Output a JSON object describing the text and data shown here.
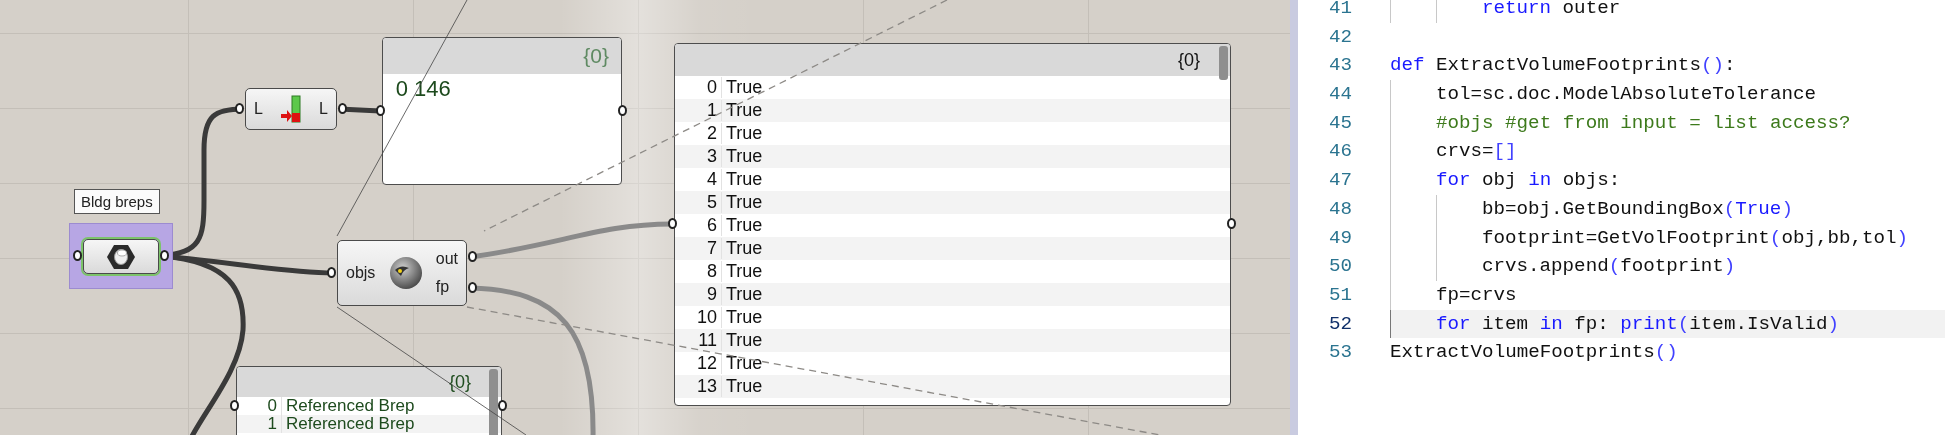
{
  "canvas": {
    "nodes": [
      {
        "kind": "param",
        "tooltip": "Bldg breps",
        "selected": true
      },
      {
        "kind": "list_length",
        "inputs": [
          "L"
        ],
        "outputs": [
          "L"
        ],
        "selected": false
      },
      {
        "kind": "python",
        "inputs": [
          "objs"
        ],
        "outputs": [
          "out",
          "fp"
        ],
        "selected": false
      }
    ],
    "panels": [
      {
        "kind": "number",
        "header": "{0}",
        "rows": [
          {
            "index": "0",
            "value": "146"
          }
        ]
      },
      {
        "kind": "boolean",
        "header": "{0}",
        "rows": [
          {
            "index": "0",
            "value": "True"
          },
          {
            "index": "1",
            "value": "True"
          },
          {
            "index": "2",
            "value": "True"
          },
          {
            "index": "3",
            "value": "True"
          },
          {
            "index": "4",
            "value": "True"
          },
          {
            "index": "5",
            "value": "True"
          },
          {
            "index": "6",
            "value": "True"
          },
          {
            "index": "7",
            "value": "True"
          },
          {
            "index": "8",
            "value": "True"
          },
          {
            "index": "9",
            "value": "True"
          },
          {
            "index": "10",
            "value": "True"
          },
          {
            "index": "11",
            "value": "True"
          },
          {
            "index": "12",
            "value": "True"
          },
          {
            "index": "13",
            "value": "True"
          }
        ]
      },
      {
        "kind": "brep",
        "header": "{0}",
        "rows": [
          {
            "index": "0",
            "value": "Referenced Brep"
          },
          {
            "index": "1",
            "value": "Referenced Brep"
          }
        ]
      }
    ]
  },
  "editor": {
    "lines": [
      {
        "number": "41",
        "current": false,
        "tokens": [
          {
            "text": "        return",
            "kind": "keyword"
          },
          {
            "text": " outer",
            "kind": "plain"
          }
        ]
      },
      {
        "number": "42",
        "current": false
      },
      {
        "number": "43",
        "current": false,
        "tokens": [
          {
            "text": "def",
            "kind": "keyword"
          },
          {
            "text": " ExtractVolumeFootprints",
            "kind": "plain"
          },
          {
            "text": "()",
            "kind": "bracket"
          },
          {
            "text": ":",
            "kind": "plain"
          }
        ]
      },
      {
        "number": "44",
        "current": false,
        "tokens": [
          {
            "text": "    tol=sc.doc.ModelAbsoluteTolerance",
            "kind": "plain"
          }
        ]
      },
      {
        "number": "45",
        "current": false,
        "tokens": [
          {
            "text": "    #objs #get from input = list access?",
            "kind": "comment"
          }
        ]
      },
      {
        "number": "46",
        "current": false,
        "tokens": [
          {
            "text": "    crvs=",
            "kind": "plain"
          },
          {
            "text": "[]",
            "kind": "bracket"
          }
        ]
      },
      {
        "number": "47",
        "current": false,
        "tokens": [
          {
            "text": "    for",
            "kind": "keyword"
          },
          {
            "text": " obj ",
            "kind": "plain"
          },
          {
            "text": "in",
            "kind": "keyword"
          },
          {
            "text": " objs:",
            "kind": "plain"
          }
        ]
      },
      {
        "number": "48",
        "current": false,
        "tokens": [
          {
            "text": "        bb=obj.GetBoundingBox",
            "kind": "plain"
          },
          {
            "text": "(",
            "kind": "bracket"
          },
          {
            "text": "True",
            "kind": "keyword"
          },
          {
            "text": ")",
            "kind": "bracket"
          }
        ]
      },
      {
        "number": "49",
        "current": false,
        "tokens": [
          {
            "text": "        footprint=GetVolFootprint",
            "kind": "plain"
          },
          {
            "text": "(",
            "kind": "bracket"
          },
          {
            "text": "obj,bb,tol",
            "kind": "plain"
          },
          {
            "text": ")",
            "kind": "bracket"
          }
        ]
      },
      {
        "number": "50",
        "current": false,
        "tokens": [
          {
            "text": "        crvs.append",
            "kind": "plain"
          },
          {
            "text": "(",
            "kind": "bracket"
          },
          {
            "text": "footprint",
            "kind": "plain"
          },
          {
            "text": ")",
            "kind": "bracket"
          }
        ]
      },
      {
        "number": "51",
        "current": false,
        "tokens": [
          {
            "text": "    fp=crvs",
            "kind": "plain"
          }
        ]
      },
      {
        "number": "52",
        "current": true,
        "tokens": [
          {
            "text": "    for",
            "kind": "keyword"
          },
          {
            "text": " item ",
            "kind": "plain"
          },
          {
            "text": "in",
            "kind": "keyword"
          },
          {
            "text": " fp: ",
            "kind": "plain"
          },
          {
            "text": "print",
            "kind": "keyword"
          },
          {
            "text": "(",
            "kind": "bracket"
          },
          {
            "text": "item.IsValid",
            "kind": "plain"
          },
          {
            "text": ")",
            "kind": "bracket"
          }
        ]
      },
      {
        "number": "53",
        "current": false,
        "tokens": [
          {
            "text": "ExtractVolumeFootprints",
            "kind": "plain"
          },
          {
            "text": "()",
            "kind": "bracket"
          }
        ]
      }
    ]
  }
}
